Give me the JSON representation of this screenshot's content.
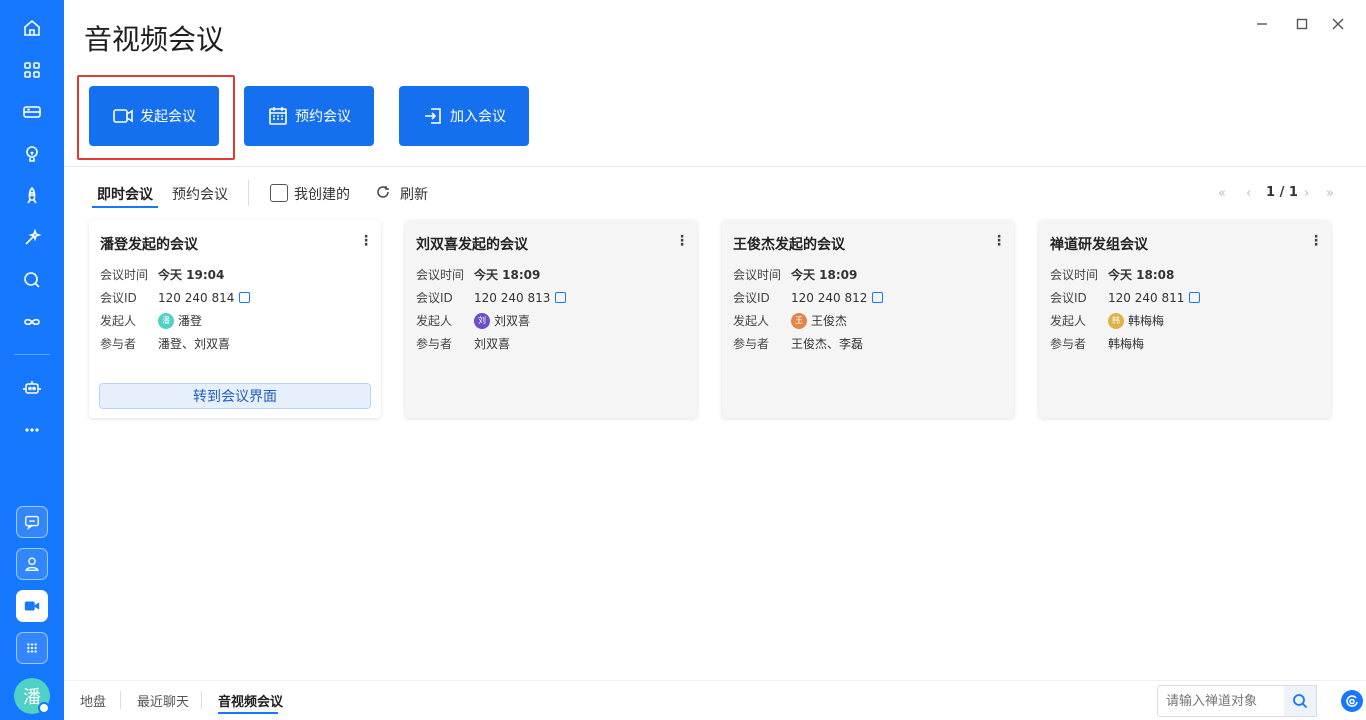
{
  "app": {
    "title": "音视频会议",
    "accent": "#1677ff"
  },
  "sidebar": {
    "icons": [
      "home-icon",
      "apps-icon",
      "inbox-icon",
      "lightbulb-icon",
      "rocket-icon",
      "sparkle-icon",
      "search-icon",
      "infinity-icon",
      "robot-icon",
      "more-icon"
    ],
    "bottom_icons": [
      "chat-icon",
      "contact-icon",
      "video-icon",
      "grid-icon"
    ],
    "avatar_text": "潘"
  },
  "actions": {
    "start": "发起会议",
    "schedule": "预约会议",
    "join": "加入会议"
  },
  "tabs": {
    "instant": "即时会议",
    "scheduled": "预约会议"
  },
  "filter": {
    "mine_label": "我创建的",
    "refresh_label": "刷新"
  },
  "pager": {
    "text": "1 / 1"
  },
  "labels": {
    "time": "会议时间",
    "id": "会议ID",
    "host": "发起人",
    "participants": "参与者"
  },
  "meetings": [
    {
      "title": "潘登发起的会议",
      "time": "今天 19:04",
      "id": "120 240 814",
      "host": "潘登",
      "host_avatar": "潘",
      "host_color": "#4fd1c5",
      "participants": "潘登、刘双喜",
      "join_label": "转到会议界面"
    },
    {
      "title": "刘双喜发起的会议",
      "time": "今天 18:09",
      "id": "120 240 813",
      "host": "刘双喜",
      "host_avatar": "刘",
      "host_color": "#6b4fc9",
      "participants": "刘双喜"
    },
    {
      "title": "王俊杰发起的会议",
      "time": "今天 18:09",
      "id": "120 240 812",
      "host": "王俊杰",
      "host_avatar": "王",
      "host_color": "#e0864a",
      "participants": "王俊杰、李磊"
    },
    {
      "title": "禅道研发组会议",
      "time": "今天 18:08",
      "id": "120 240 811",
      "host": "韩梅梅",
      "host_avatar": "韩",
      "host_color": "#e0b04a",
      "participants": "韩梅梅"
    }
  ],
  "bottom": {
    "tabs": [
      "地盘",
      "最近聊天",
      "音视频会议"
    ],
    "search_placeholder": "请输入禅道对象"
  }
}
